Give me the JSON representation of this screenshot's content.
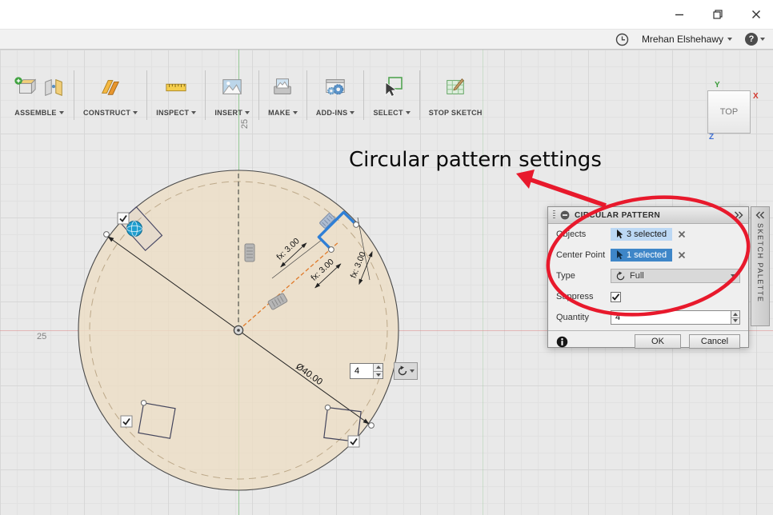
{
  "appbar": {
    "username": "Mrehan Elshehawy",
    "help": "?"
  },
  "toolbar": {
    "items": [
      {
        "label": "ASSEMBLE"
      },
      {
        "label": "CONSTRUCT"
      },
      {
        "label": "INSPECT"
      },
      {
        "label": "INSERT"
      },
      {
        "label": "MAKE"
      },
      {
        "label": "ADD-INS"
      },
      {
        "label": "SELECT"
      },
      {
        "label": "STOP SKETCH"
      }
    ]
  },
  "viewcube": {
    "face": "TOP",
    "axis_x": "X",
    "axis_y": "Y",
    "axis_z": "Z"
  },
  "canvas": {
    "ruler_left": "25",
    "ruler_top": "25",
    "diameter_label": "Ø40.00",
    "fx_labels": [
      "fx: 3.00",
      "fx: 3.00",
      "fx: 3.00"
    ],
    "quantity_value": "4"
  },
  "annotation": {
    "text": "Circular pattern settings"
  },
  "dialog": {
    "title": "CIRCULAR PATTERN",
    "objects_label": "Objects",
    "objects_value": "3 selected",
    "center_point_label": "Center Point",
    "center_point_value": "1 selected",
    "type_label": "Type",
    "type_value": "Full",
    "suppress_label": "Suppress",
    "quantity_label": "Quantity",
    "quantity_value": "4",
    "ok_label": "OK",
    "cancel_label": "Cancel"
  },
  "sketch_palette": {
    "label": "SKETCH PALETTE"
  },
  "colors": {
    "accent_blue": "#3e86c8",
    "selection_light_blue": "#bcd8f4",
    "selected_geometry_blue": "#2f7fd6",
    "annotation_red": "#e8192c",
    "sketch_fill": "#ecddc4",
    "construction_orange": "#e07a2a"
  }
}
